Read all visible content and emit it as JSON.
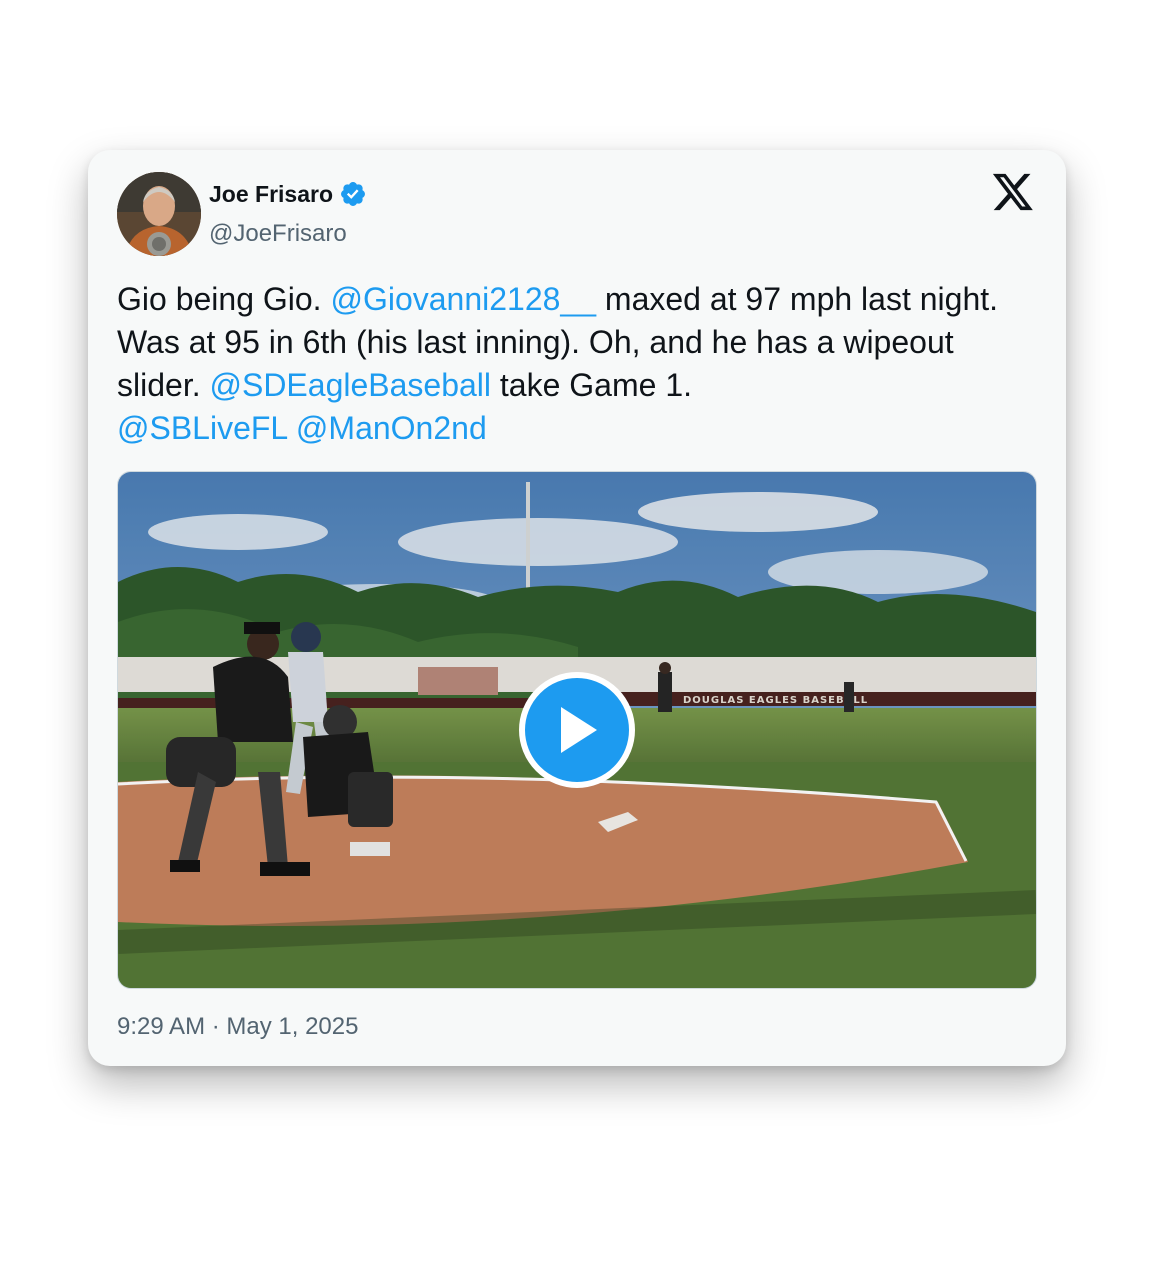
{
  "author": {
    "name": "Joe Frisaro",
    "handle": "@JoeFrisaro"
  },
  "tweet": {
    "text_parts": [
      {
        "text": "Gio being Gio. ",
        "type": "plain"
      },
      {
        "text": "@Giovanni2128__",
        "type": "mention"
      },
      {
        "text": " maxed at 97 mph last night. Was at 95 in 6th (his last inning). Oh, and he has a wipeout slider. ",
        "type": "plain"
      },
      {
        "text": "@SDEagleBaseball",
        "type": "mention"
      },
      {
        "text": " take Game 1. ",
        "type": "plain"
      },
      {
        "text": "@SBLiveFL",
        "type": "mention"
      },
      {
        "text": " ",
        "type": "plain"
      },
      {
        "text": "@ManOn2nd",
        "type": "mention"
      }
    ],
    "timestamp": "9:29 AM · May 1, 2025"
  },
  "media": {
    "outfield_sign": "DOUGLAS EAGLES BASEBALL"
  },
  "icons": {
    "verified": "verified-badge-icon",
    "platform": "x-logo-icon",
    "play": "play-icon"
  },
  "colors": {
    "mention": "#1d9bf0",
    "verified": "#1d9bf0",
    "text": "#0f1419",
    "secondary": "#536471",
    "card_bg": "#f7f9f9"
  }
}
